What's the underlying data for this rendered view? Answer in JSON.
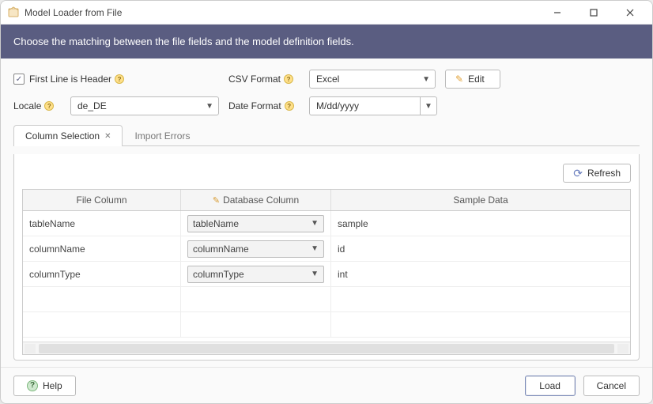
{
  "window": {
    "title": "Model Loader from File"
  },
  "banner": {
    "text": "Choose the matching between the file fields and the model definition fields."
  },
  "form": {
    "first_line_label": "First Line is Header",
    "csv_format_label": "CSV Format",
    "csv_format_value": "Excel",
    "edit_label": "Edit",
    "locale_label": "Locale",
    "locale_value": "de_DE",
    "date_format_label": "Date Format",
    "date_format_value": "M/dd/yyyy"
  },
  "tabs": {
    "column_selection": "Column Selection",
    "import_errors": "Import Errors"
  },
  "toolbar": {
    "refresh": "Refresh"
  },
  "grid": {
    "headers": {
      "file": "File Column",
      "db": "Database Column",
      "sample": "Sample Data"
    },
    "rows": [
      {
        "file": "tableName",
        "db": "tableName",
        "sample": "sample"
      },
      {
        "file": "columnName",
        "db": "columnName",
        "sample": "id"
      },
      {
        "file": "columnType",
        "db": "columnType",
        "sample": "int"
      }
    ]
  },
  "footer": {
    "help": "Help",
    "load": "Load",
    "cancel": "Cancel"
  }
}
